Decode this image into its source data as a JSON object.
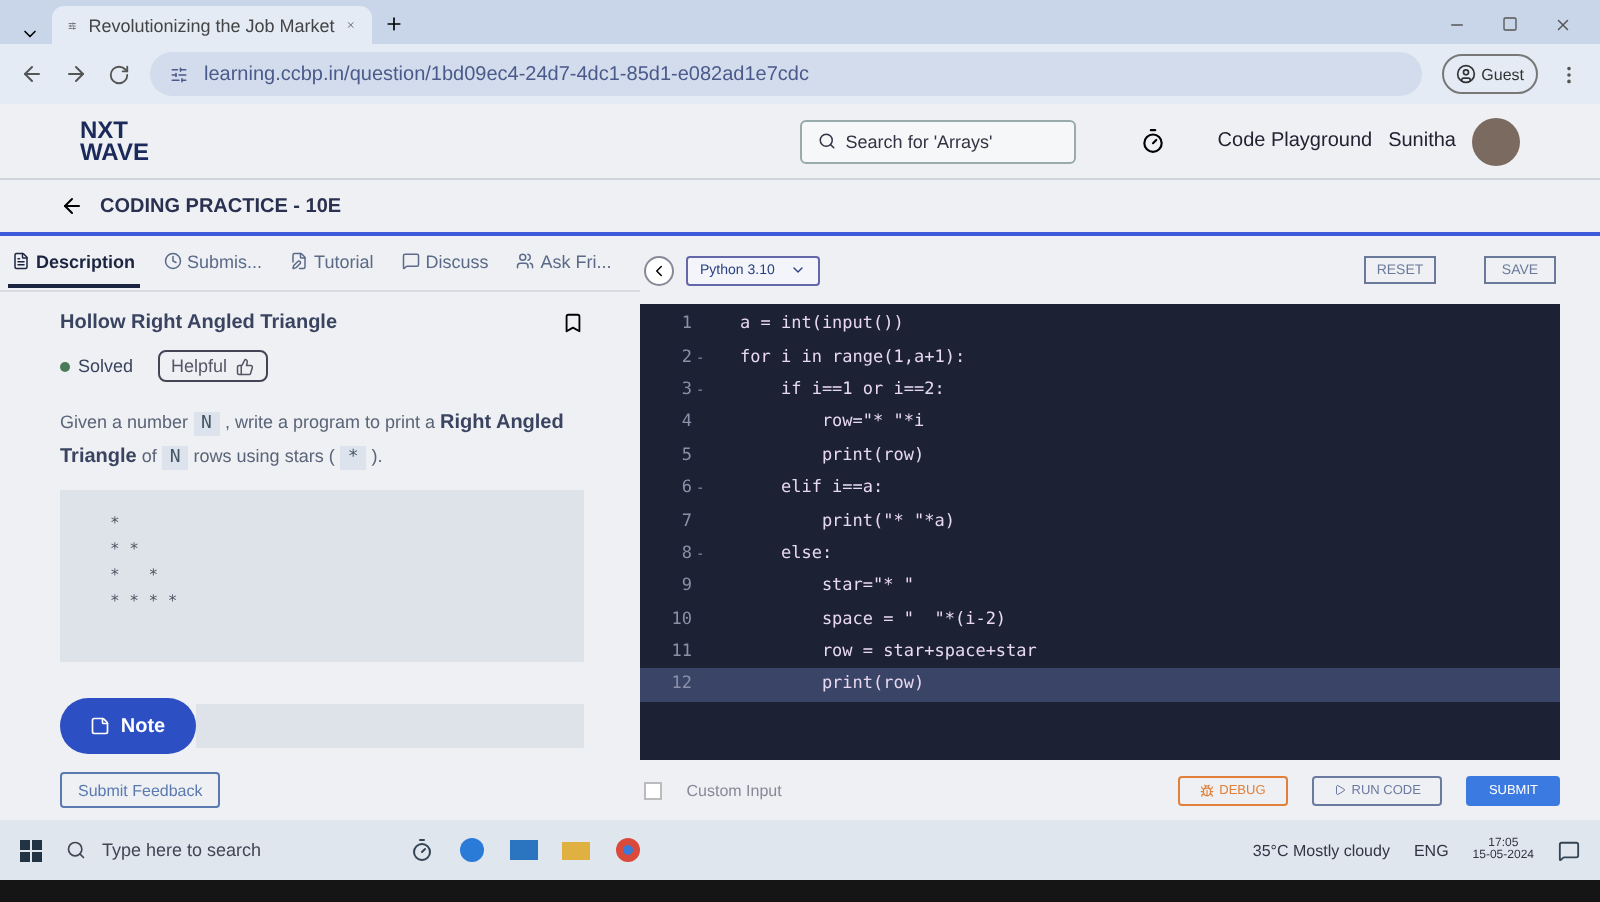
{
  "browser": {
    "tab_title": "Revolutionizing the Job Market",
    "url": "learning.ccbp.in/question/1bd09ec4-24d7-4dc1-85d1-e082ad1e7cdc",
    "profile": "Guest"
  },
  "header": {
    "logo_top": "NXT",
    "logo_bottom": "WAVE",
    "search_placeholder": "Search for 'Arrays'",
    "playground": "Code Playground",
    "user": "Sunitha"
  },
  "practice_title": "CODING PRACTICE - 10E",
  "tabs": [
    {
      "label": "Description",
      "selected": true
    },
    {
      "label": "Submis...",
      "selected": false
    },
    {
      "label": "Tutorial",
      "selected": false
    },
    {
      "label": "Discuss",
      "selected": false
    },
    {
      "label": "Ask Fri...",
      "selected": false
    }
  ],
  "problem": {
    "title": "Hollow Right Angled Triangle",
    "status": "Solved",
    "helpful": "Helpful",
    "description": [
      {
        "kind": "text",
        "text": "Given a number "
      },
      {
        "kind": "code",
        "text": "N"
      },
      {
        "kind": "text",
        "text": " , write a program to print a "
      },
      {
        "kind": "bold",
        "text": "Right Angled Triangle"
      },
      {
        "kind": "text",
        "text": " of "
      },
      {
        "kind": "code",
        "text": "N"
      },
      {
        "kind": "text",
        "text": " rows using stars ( "
      },
      {
        "kind": "code",
        "text": "*"
      },
      {
        "kind": "text",
        "text": " )."
      }
    ],
    "sample_output": "*\n* *\n*   *\n* * * *",
    "note": "Note"
  },
  "editor": {
    "language": "Python 3.10",
    "reset": "RESET",
    "save": "SAVE",
    "lines": [
      {
        "number": "1",
        "code": "a = int(input())",
        "current": false
      },
      {
        "number": "2",
        "fold": "-",
        "code": "for i in range(1,a+1):",
        "current": false
      },
      {
        "number": "3",
        "fold": "-",
        "code": "    if i==1 or i==2:",
        "current": false
      },
      {
        "number": "4",
        "code": "        row=\"* \"*i",
        "current": false
      },
      {
        "number": "5",
        "code": "        print(row)",
        "current": false
      },
      {
        "number": "6",
        "fold": "-",
        "code": "    elif i==a:",
        "current": false
      },
      {
        "number": "7",
        "code": "        print(\"* \"*a)",
        "current": false
      },
      {
        "number": "8",
        "fold": "-",
        "code": "    else:",
        "current": false
      },
      {
        "number": "9",
        "code": "        star=\"* \"",
        "current": false
      },
      {
        "number": "10",
        "code": "        space = \"  \"*(i-2)",
        "current": false
      },
      {
        "number": "11",
        "code": "        row = star+space+star",
        "current": false
      },
      {
        "number": "12",
        "code": "        print(row)",
        "current": true
      }
    ]
  },
  "footer": {
    "feedback": "Submit Feedback",
    "custom_input": {
      "label": "Custom Input",
      "checked": false
    },
    "debug": "DEBUG",
    "run": "RUN CODE",
    "submit": "SUBMIT"
  },
  "taskbar": {
    "search_placeholder": "Type here to search",
    "weather": "35°C  Mostly cloudy",
    "language": "ENG",
    "time": "17:05",
    "date": "15-05-2024"
  }
}
